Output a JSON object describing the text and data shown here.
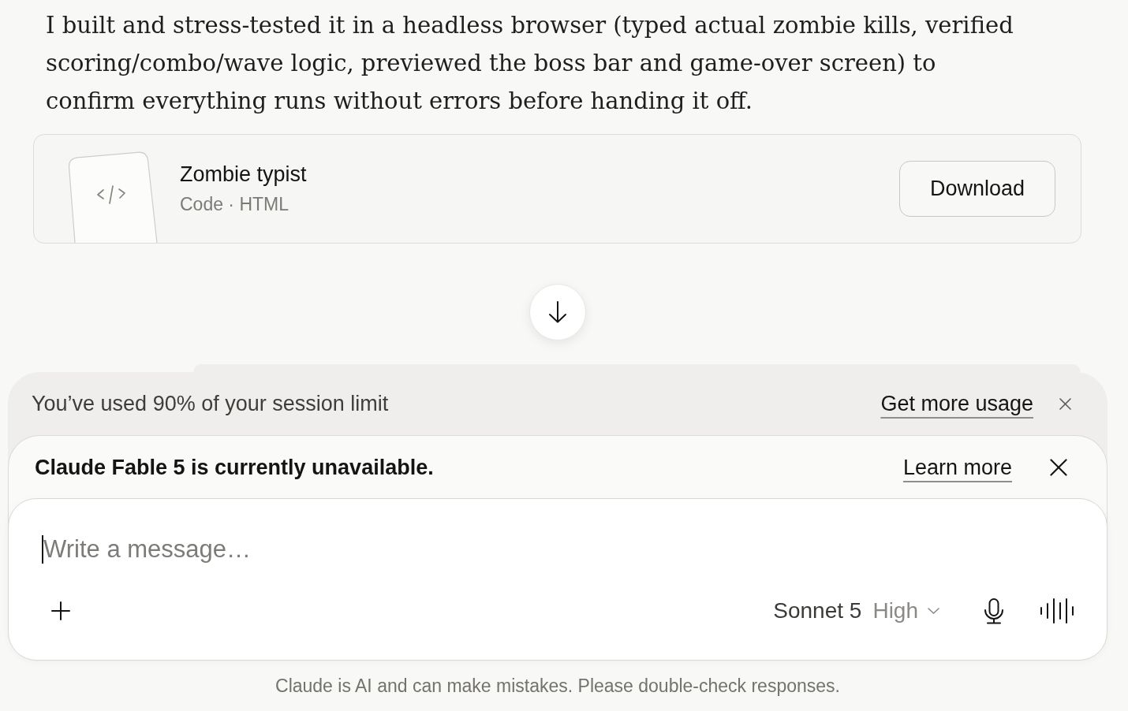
{
  "message": {
    "text": "I built and stress-tested it in a headless browser (typed actual zombie kills, verified scoring/combo/wave logic, previewed the boss bar and game-over screen) to confirm everything runs without errors before handing it off."
  },
  "artifact": {
    "title": "Zombie typist",
    "subtitle": "Code · HTML",
    "button": "Download"
  },
  "usage_notice": {
    "text": "You’ve used 90% of your session limit",
    "link": "Get more usage"
  },
  "model_notice": {
    "text": "Claude Fable 5 is currently unavailable.",
    "link": "Learn more"
  },
  "composer": {
    "placeholder": "Write a message…",
    "model": "Sonnet 5",
    "effort": "High"
  },
  "disclaimer": "Claude is AI and can make mistakes. Please double-check responses."
}
